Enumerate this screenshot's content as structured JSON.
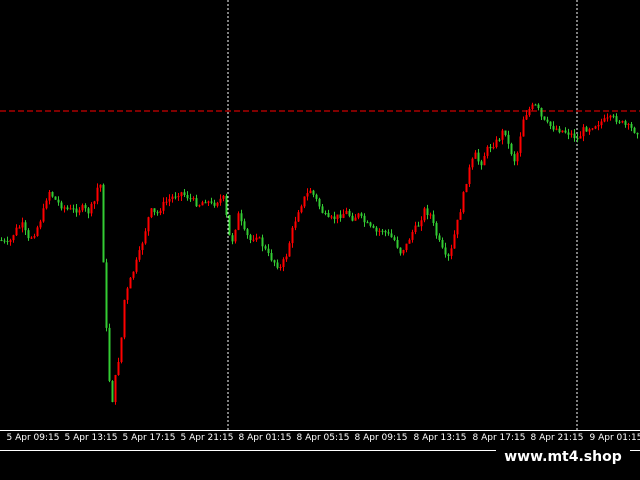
{
  "watermark": "www.mt4.shop",
  "colors": {
    "bull": "#ff0000",
    "bear": "#33cc33",
    "background": "#000000",
    "text": "#ffffff",
    "price_line": "#ff0000",
    "separator": "#ffffff"
  },
  "chart_data": {
    "type": "candlestick",
    "x_ticks": [
      "5 Apr 09:15",
      "5 Apr 13:15",
      "5 Apr 17:15",
      "5 Apr 21:15",
      "8 Apr 01:15",
      "8 Apr 05:15",
      "8 Apr 09:15",
      "8 Apr 13:15",
      "8 Apr 17:15",
      "8 Apr 21:15",
      "9 Apr 01:15"
    ],
    "day_separators_after_ticks": [
      "5 Apr 21:15",
      "8 Apr 21:15"
    ],
    "price_line": "dashed horizontal level near top",
    "candle_path": [
      [
        0,
        240
      ],
      [
        8,
        245
      ],
      [
        15,
        230
      ],
      [
        22,
        225
      ],
      [
        28,
        240
      ],
      [
        35,
        232
      ],
      [
        42,
        215
      ],
      [
        48,
        190
      ],
      [
        55,
        200
      ],
      [
        60,
        205
      ],
      [
        68,
        210
      ],
      [
        75,
        210
      ],
      [
        82,
        208
      ],
      [
        88,
        212
      ],
      [
        95,
        200
      ],
      [
        98,
        182
      ],
      [
        100,
        185
      ],
      [
        103,
        260
      ],
      [
        106,
        330
      ],
      [
        109,
        380
      ],
      [
        112,
        400
      ],
      [
        116,
        370
      ],
      [
        120,
        350
      ],
      [
        124,
        300
      ],
      [
        130,
        280
      ],
      [
        135,
        265
      ],
      [
        140,
        250
      ],
      [
        145,
        230
      ],
      [
        150,
        210
      ],
      [
        156,
        215
      ],
      [
        162,
        205
      ],
      [
        168,
        200
      ],
      [
        175,
        195
      ],
      [
        180,
        192
      ],
      [
        186,
        196
      ],
      [
        192,
        200
      ],
      [
        198,
        205
      ],
      [
        205,
        200
      ],
      [
        212,
        205
      ],
      [
        218,
        200
      ],
      [
        224,
        198
      ],
      [
        228,
        235
      ],
      [
        232,
        240
      ],
      [
        238,
        215
      ],
      [
        244,
        232
      ],
      [
        250,
        240
      ],
      [
        256,
        235
      ],
      [
        262,
        245
      ],
      [
        268,
        255
      ],
      [
        274,
        262
      ],
      [
        280,
        268
      ],
      [
        286,
        255
      ],
      [
        292,
        230
      ],
      [
        298,
        210
      ],
      [
        304,
        198
      ],
      [
        310,
        190
      ],
      [
        316,
        200
      ],
      [
        322,
        212
      ],
      [
        328,
        220
      ],
      [
        334,
        218
      ],
      [
        340,
        215
      ],
      [
        346,
        212
      ],
      [
        352,
        218
      ],
      [
        358,
        215
      ],
      [
        364,
        222
      ],
      [
        370,
        228
      ],
      [
        376,
        232
      ],
      [
        382,
        230
      ],
      [
        388,
        235
      ],
      [
        394,
        240
      ],
      [
        400,
        252
      ],
      [
        406,
        245
      ],
      [
        412,
        232
      ],
      [
        418,
        225
      ],
      [
        424,
        210
      ],
      [
        430,
        215
      ],
      [
        436,
        235
      ],
      [
        442,
        250
      ],
      [
        446,
        260
      ],
      [
        450,
        255
      ],
      [
        455,
        230
      ],
      [
        460,
        210
      ],
      [
        465,
        185
      ],
      [
        470,
        165
      ],
      [
        475,
        155
      ],
      [
        480,
        165
      ],
      [
        486,
        150
      ],
      [
        492,
        145
      ],
      [
        498,
        140
      ],
      [
        504,
        128
      ],
      [
        508,
        145
      ],
      [
        514,
        160
      ],
      [
        518,
        150
      ],
      [
        522,
        120
      ],
      [
        528,
        110
      ],
      [
        534,
        105
      ],
      [
        538,
        110
      ],
      [
        542,
        120
      ],
      [
        548,
        125
      ],
      [
        554,
        128
      ],
      [
        560,
        130
      ],
      [
        566,
        132
      ],
      [
        572,
        135
      ],
      [
        578,
        140
      ],
      [
        582,
        130
      ],
      [
        588,
        128
      ],
      [
        594,
        125
      ],
      [
        600,
        122
      ],
      [
        606,
        120
      ],
      [
        612,
        118
      ],
      [
        618,
        120
      ],
      [
        624,
        125
      ],
      [
        630,
        128
      ],
      [
        636,
        132
      ],
      [
        640,
        130
      ]
    ]
  }
}
